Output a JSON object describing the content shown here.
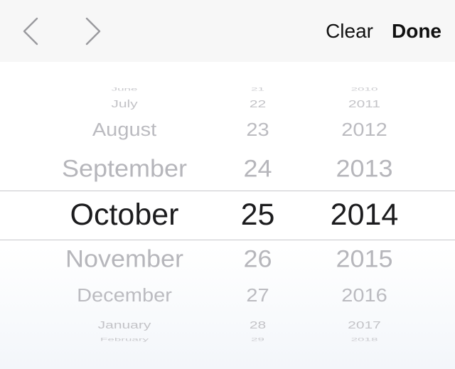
{
  "toolbar": {
    "prev_icon": "chevron-left-icon",
    "next_icon": "chevron-right-icon",
    "clear_label": "Clear",
    "done_label": "Done"
  },
  "picker": {
    "months": [
      "June",
      "July",
      "August",
      "September",
      "October",
      "November",
      "December",
      "January",
      "February"
    ],
    "days": [
      "21",
      "22",
      "23",
      "24",
      "25",
      "26",
      "27",
      "28",
      "29"
    ],
    "years": [
      "2010",
      "2011",
      "2012",
      "2013",
      "2014",
      "2015",
      "2016",
      "2017",
      "2018"
    ],
    "selected": {
      "month": "October",
      "day": "25",
      "year": "2014"
    }
  },
  "colors": {
    "toolbar_bg": "#f7f7f7",
    "selected_text": "#1c1c1e",
    "unselected_text": "#b3b3b8",
    "separator": "#c8c8cc"
  }
}
